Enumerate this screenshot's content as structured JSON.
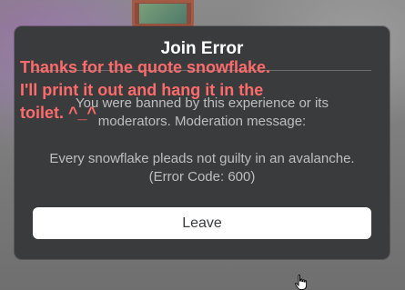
{
  "dialog": {
    "title": "Join Error",
    "message_line1": "You were banned by this experience or its",
    "message_line2": "moderators. Moderation message:",
    "reason_line1": "Every snowflake pleads not guilty in an avalanche.",
    "reason_line2": "(Error Code: 600)",
    "leave_label": "Leave"
  },
  "overlay": {
    "line1": "Thanks for the quote snowflake.",
    "line2": "I'll print it out and hang it in the",
    "line3": "toilet. ^_^"
  },
  "colors": {
    "dialog_bg": "#393b3d",
    "overlay_text": "#ff6b6b",
    "button_bg": "#ffffff"
  },
  "icons": {
    "cursor": "hand-pointer-icon"
  }
}
